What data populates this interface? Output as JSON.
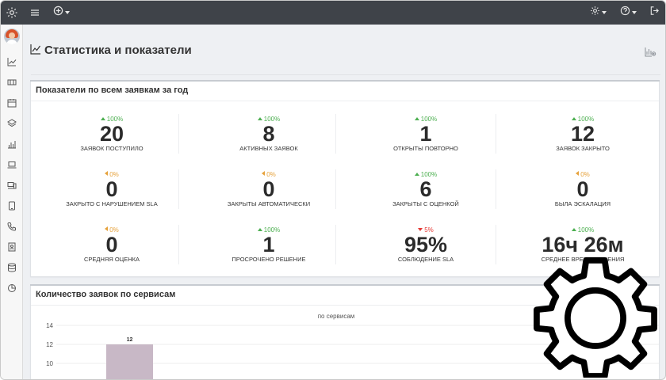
{
  "header": {
    "page_title": "Статистика и показатели"
  },
  "icons": {
    "sidebar": [
      "settings-icon",
      "line-chart-icon",
      "ticket-icon",
      "calendar-icon",
      "layers-icon",
      "bar-chart-icon",
      "laptop-icon",
      "devices-icon",
      "tablet-icon",
      "phone-icon",
      "contact-card-icon",
      "database-icon",
      "pie-chart-icon"
    ],
    "topbar": [
      "menu-icon",
      "add-circle-icon",
      "gear-icon",
      "help-icon",
      "logout-icon"
    ]
  },
  "summary": {
    "title": "Показатели по всем заявкам за год",
    "metrics": [
      {
        "delta": "100%",
        "trend": "up",
        "value": "20",
        "label": "заявок поступило"
      },
      {
        "delta": "100%",
        "trend": "up",
        "value": "8",
        "label": "активных заявок"
      },
      {
        "delta": "100%",
        "trend": "up",
        "value": "1",
        "label": "открыты повторно"
      },
      {
        "delta": "100%",
        "trend": "up",
        "value": "12",
        "label": "заявок закрыто"
      },
      {
        "delta": "0%",
        "trend": "neutral",
        "value": "0",
        "label": "закрыто с нарушением SLA"
      },
      {
        "delta": "0%",
        "trend": "neutral",
        "value": "0",
        "label": "закрыты автоматически"
      },
      {
        "delta": "100%",
        "trend": "up",
        "value": "6",
        "label": "закрыты с оценкой"
      },
      {
        "delta": "0%",
        "trend": "neutral",
        "value": "0",
        "label": "была эскалация"
      },
      {
        "delta": "0%",
        "trend": "neutral",
        "value": "0",
        "label": "средняя оценка"
      },
      {
        "delta": "100%",
        "trend": "up",
        "value": "1",
        "label": "просрочено решение"
      },
      {
        "delta": "5%",
        "trend": "down",
        "value": "95%",
        "label": "соблюдение SLA"
      },
      {
        "delta": "100%",
        "trend": "up",
        "value": "16ч 26м",
        "label": "среднее время решения"
      }
    ]
  },
  "services": {
    "title": "Количество заявок по сервисам"
  },
  "chart_data": {
    "type": "bar",
    "title": "по сервисам",
    "y_ticks": [
      14,
      12,
      10
    ],
    "ylim": [
      0,
      14
    ],
    "grid": true,
    "series": [
      {
        "values": [
          12
        ]
      }
    ],
    "data_labels": [
      "12"
    ],
    "bar_color": "#c8b8c6"
  },
  "colors": {
    "topbar": "#3f4349",
    "delta_up": "#4caf50",
    "delta_down": "#e53935",
    "delta_neutral": "#e6a23c"
  }
}
